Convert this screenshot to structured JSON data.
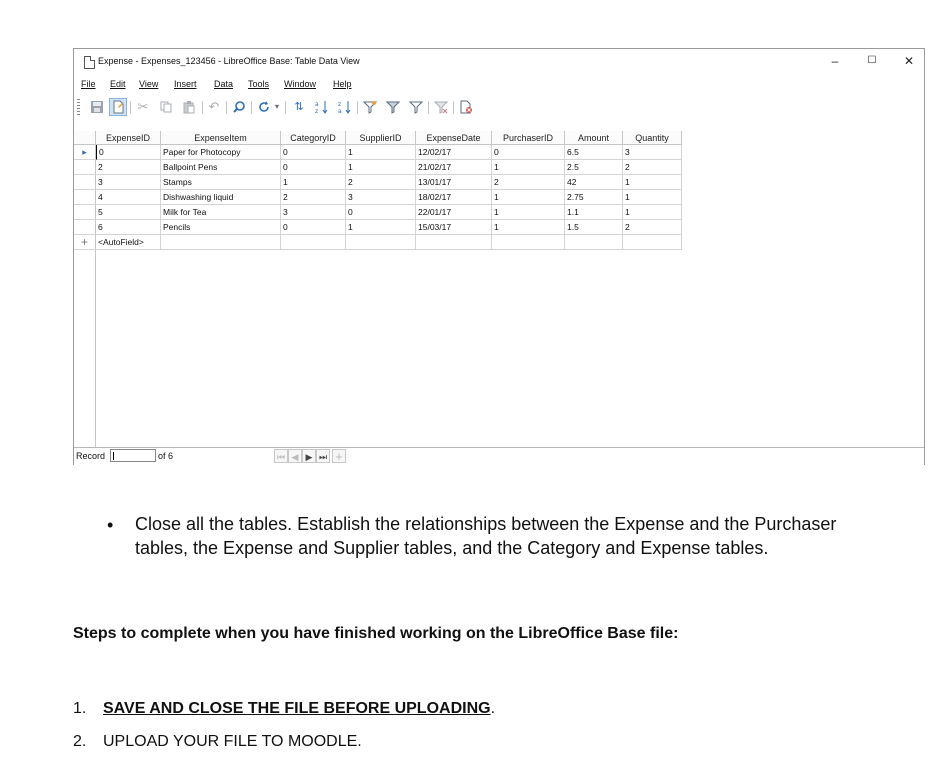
{
  "window": {
    "title": "Expense - Expenses_123456 - LibreOffice Base: Table Data View",
    "controls": [
      "–",
      "☐",
      "✕"
    ]
  },
  "menu": [
    "File",
    "Edit",
    "View",
    "Insert",
    "Data",
    "Tools",
    "Window",
    "Help"
  ],
  "toolbar_icons": [
    "save-icon",
    "edit-doc-icon",
    "cut-icon",
    "copy-icon",
    "paste-icon",
    "undo-icon",
    "find-icon",
    "refresh-icon",
    "sort-icon",
    "sort-ascending-icon",
    "sort-descending-icon",
    "autofilter-icon",
    "standard-filter-icon",
    "apply-filter-icon",
    "reset-filter-icon",
    "delete-record-icon"
  ],
  "table": {
    "columns": [
      "ExpenseID",
      "ExpenseItem",
      "CategoryID",
      "SupplierID",
      "ExpenseDate",
      "PurchaserID",
      "Amount",
      "Quantity"
    ],
    "rows": [
      [
        "0",
        "Paper for Photocopy",
        "0",
        "1",
        "12/02/17",
        "0",
        "6.5",
        "3"
      ],
      [
        "2",
        "Ballpoint Pens",
        "0",
        "1",
        "21/02/17",
        "1",
        "2.5",
        "2"
      ],
      [
        "3",
        "Stamps",
        "1",
        "2",
        "13/01/17",
        "2",
        "42",
        "1"
      ],
      [
        "4",
        "Dishwashing liquid",
        "2",
        "3",
        "18/02/17",
        "1",
        "2.75",
        "1"
      ],
      [
        "5",
        "Milk for Tea",
        "3",
        "0",
        "22/01/17",
        "1",
        "1.1",
        "1"
      ],
      [
        "6",
        "Pencils",
        "0",
        "1",
        "15/03/17",
        "1",
        "1.5",
        "2"
      ]
    ],
    "new_row_marker": "+",
    "new_row_value": "<AutoField>",
    "current_row_marker": "▸"
  },
  "statusbar": {
    "record_label": "Record",
    "of_label": "of 6"
  },
  "document": {
    "bullet": "•",
    "bullet_text": "Close all the tables. Establish the relationships between the Expense and the Purchaser tables, the Expense and Supplier tables, and the Category and Expense tables.",
    "steps_heading": "Steps to complete when you have finished working on the LibreOffice Base file:",
    "steps": [
      {
        "num": "1.",
        "text": "SAVE AND CLOSE THE FILE BEFORE UPLOADING",
        "suffix": "."
      },
      {
        "num": "2.",
        "text": "UPLOAD YOUR FILE TO MOODLE."
      }
    ]
  }
}
